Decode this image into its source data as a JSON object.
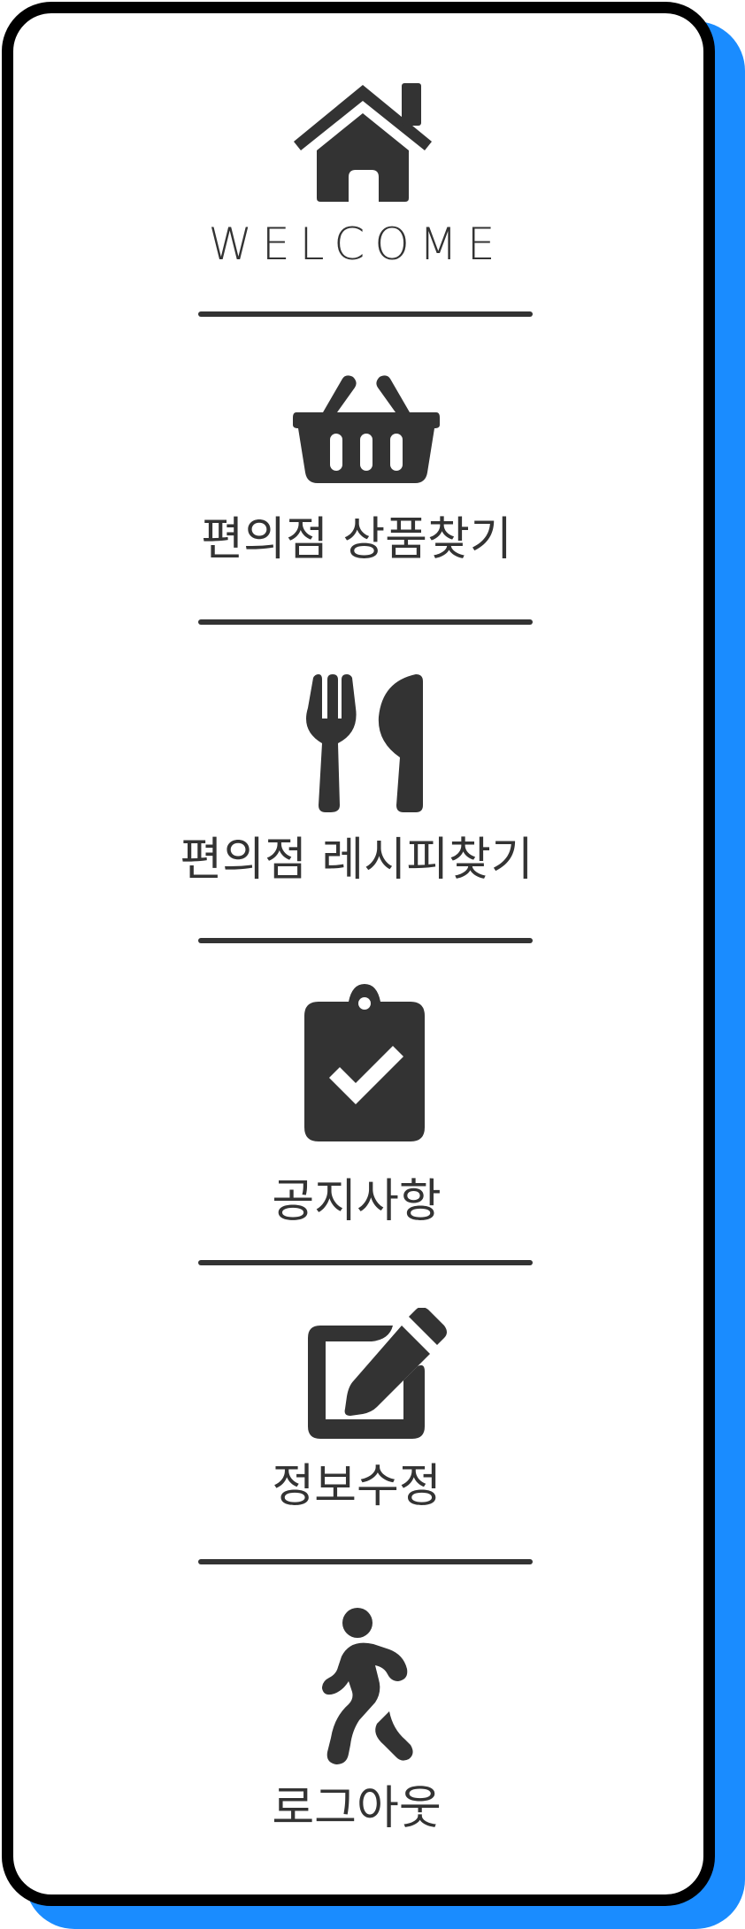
{
  "menu": {
    "items": [
      {
        "icon": "home-icon",
        "label": "WELCOME"
      },
      {
        "icon": "shopping-basket-icon",
        "label": "편의점 상품찾기"
      },
      {
        "icon": "restaurant-icon",
        "label": "편의점 레시피찾기"
      },
      {
        "icon": "clipboard-check-icon",
        "label": "공지사항"
      },
      {
        "icon": "edit-icon",
        "label": "정보수정"
      },
      {
        "icon": "walking-person-icon",
        "label": "로그아웃"
      }
    ]
  },
  "colors": {
    "icon": "#333333",
    "border": "#000000",
    "shadow": "#1a8cff",
    "background": "#ffffff"
  }
}
